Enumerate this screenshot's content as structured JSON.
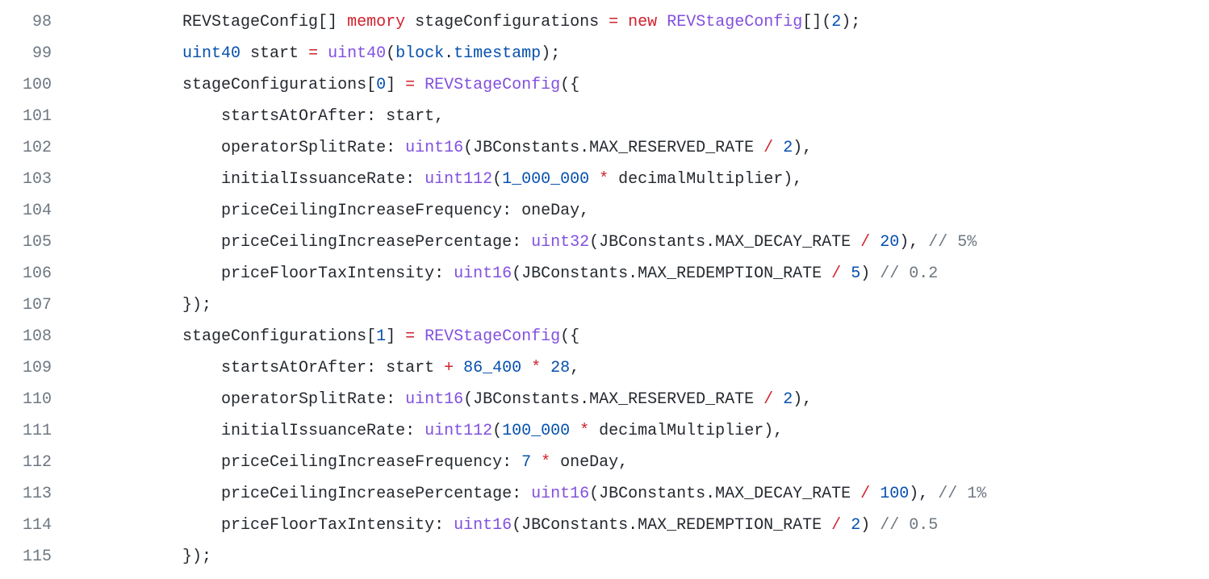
{
  "lines": [
    {
      "num": "98",
      "indent": 3,
      "tokens": [
        {
          "t": "pl",
          "v": "REVStageConfig[] "
        },
        {
          "t": "kw-red",
          "v": "memory"
        },
        {
          "t": "pl",
          "v": " stageConfigurations "
        },
        {
          "t": "op",
          "v": "="
        },
        {
          "t": "pl",
          "v": " "
        },
        {
          "t": "kw-red",
          "v": "new"
        },
        {
          "t": "pl",
          "v": " "
        },
        {
          "t": "fn",
          "v": "REVStageConfig"
        },
        {
          "t": "pl",
          "v": "[]("
        },
        {
          "t": "kw-blue",
          "v": "2"
        },
        {
          "t": "pl",
          "v": ");"
        }
      ]
    },
    {
      "num": "99",
      "indent": 3,
      "tokens": [
        {
          "t": "kw-blue",
          "v": "uint40"
        },
        {
          "t": "pl",
          "v": " start "
        },
        {
          "t": "op",
          "v": "="
        },
        {
          "t": "pl",
          "v": " "
        },
        {
          "t": "fn",
          "v": "uint40"
        },
        {
          "t": "pl",
          "v": "("
        },
        {
          "t": "kw-blue",
          "v": "block"
        },
        {
          "t": "pl",
          "v": "."
        },
        {
          "t": "kw-blue",
          "v": "timestamp"
        },
        {
          "t": "pl",
          "v": ");"
        }
      ]
    },
    {
      "num": "100",
      "indent": 3,
      "tokens": [
        {
          "t": "pl",
          "v": "stageConfigurations["
        },
        {
          "t": "kw-blue",
          "v": "0"
        },
        {
          "t": "pl",
          "v": "] "
        },
        {
          "t": "op",
          "v": "="
        },
        {
          "t": "pl",
          "v": " "
        },
        {
          "t": "fn",
          "v": "REVStageConfig"
        },
        {
          "t": "pl",
          "v": "({"
        }
      ]
    },
    {
      "num": "101",
      "indent": 4,
      "tokens": [
        {
          "t": "pl",
          "v": "startsAtOrAfter: start,"
        }
      ]
    },
    {
      "num": "102",
      "indent": 4,
      "tokens": [
        {
          "t": "pl",
          "v": "operatorSplitRate: "
        },
        {
          "t": "fn",
          "v": "uint16"
        },
        {
          "t": "pl",
          "v": "(JBConstants.MAX_RESERVED_RATE "
        },
        {
          "t": "op",
          "v": "/"
        },
        {
          "t": "pl",
          "v": " "
        },
        {
          "t": "kw-blue",
          "v": "2"
        },
        {
          "t": "pl",
          "v": "),"
        }
      ]
    },
    {
      "num": "103",
      "indent": 4,
      "tokens": [
        {
          "t": "pl",
          "v": "initialIssuanceRate: "
        },
        {
          "t": "fn",
          "v": "uint112"
        },
        {
          "t": "pl",
          "v": "("
        },
        {
          "t": "kw-blue",
          "v": "1_000_000"
        },
        {
          "t": "pl",
          "v": " "
        },
        {
          "t": "op",
          "v": "*"
        },
        {
          "t": "pl",
          "v": " decimalMultiplier),"
        }
      ]
    },
    {
      "num": "104",
      "indent": 4,
      "tokens": [
        {
          "t": "pl",
          "v": "priceCeilingIncreaseFrequency: oneDay,"
        }
      ]
    },
    {
      "num": "105",
      "indent": 4,
      "tokens": [
        {
          "t": "pl",
          "v": "priceCeilingIncreasePercentage: "
        },
        {
          "t": "fn",
          "v": "uint32"
        },
        {
          "t": "pl",
          "v": "(JBConstants.MAX_DECAY_RATE "
        },
        {
          "t": "op",
          "v": "/"
        },
        {
          "t": "pl",
          "v": " "
        },
        {
          "t": "kw-blue",
          "v": "20"
        },
        {
          "t": "pl",
          "v": "), "
        },
        {
          "t": "cm",
          "v": "// 5%"
        }
      ]
    },
    {
      "num": "106",
      "indent": 4,
      "tokens": [
        {
          "t": "pl",
          "v": "priceFloorTaxIntensity: "
        },
        {
          "t": "fn",
          "v": "uint16"
        },
        {
          "t": "pl",
          "v": "(JBConstants.MAX_REDEMPTION_RATE "
        },
        {
          "t": "op",
          "v": "/"
        },
        {
          "t": "pl",
          "v": " "
        },
        {
          "t": "kw-blue",
          "v": "5"
        },
        {
          "t": "pl",
          "v": ") "
        },
        {
          "t": "cm",
          "v": "// 0.2"
        }
      ]
    },
    {
      "num": "107",
      "indent": 3,
      "tokens": [
        {
          "t": "pl",
          "v": "});"
        }
      ]
    },
    {
      "num": "108",
      "indent": 3,
      "tokens": [
        {
          "t": "pl",
          "v": "stageConfigurations["
        },
        {
          "t": "kw-blue",
          "v": "1"
        },
        {
          "t": "pl",
          "v": "] "
        },
        {
          "t": "op",
          "v": "="
        },
        {
          "t": "pl",
          "v": " "
        },
        {
          "t": "fn",
          "v": "REVStageConfig"
        },
        {
          "t": "pl",
          "v": "({"
        }
      ]
    },
    {
      "num": "109",
      "indent": 4,
      "tokens": [
        {
          "t": "pl",
          "v": "startsAtOrAfter: start "
        },
        {
          "t": "op",
          "v": "+"
        },
        {
          "t": "pl",
          "v": " "
        },
        {
          "t": "kw-blue",
          "v": "86_400"
        },
        {
          "t": "pl",
          "v": " "
        },
        {
          "t": "op",
          "v": "*"
        },
        {
          "t": "pl",
          "v": " "
        },
        {
          "t": "kw-blue",
          "v": "28"
        },
        {
          "t": "pl",
          "v": ","
        }
      ]
    },
    {
      "num": "110",
      "indent": 4,
      "tokens": [
        {
          "t": "pl",
          "v": "operatorSplitRate: "
        },
        {
          "t": "fn",
          "v": "uint16"
        },
        {
          "t": "pl",
          "v": "(JBConstants.MAX_RESERVED_RATE "
        },
        {
          "t": "op",
          "v": "/"
        },
        {
          "t": "pl",
          "v": " "
        },
        {
          "t": "kw-blue",
          "v": "2"
        },
        {
          "t": "pl",
          "v": "),"
        }
      ]
    },
    {
      "num": "111",
      "indent": 4,
      "tokens": [
        {
          "t": "pl",
          "v": "initialIssuanceRate: "
        },
        {
          "t": "fn",
          "v": "uint112"
        },
        {
          "t": "pl",
          "v": "("
        },
        {
          "t": "kw-blue",
          "v": "100_000"
        },
        {
          "t": "pl",
          "v": " "
        },
        {
          "t": "op",
          "v": "*"
        },
        {
          "t": "pl",
          "v": " decimalMultiplier),"
        }
      ]
    },
    {
      "num": "112",
      "indent": 4,
      "tokens": [
        {
          "t": "pl",
          "v": "priceCeilingIncreaseFrequency: "
        },
        {
          "t": "kw-blue",
          "v": "7"
        },
        {
          "t": "pl",
          "v": " "
        },
        {
          "t": "op",
          "v": "*"
        },
        {
          "t": "pl",
          "v": " oneDay,"
        }
      ]
    },
    {
      "num": "113",
      "indent": 4,
      "tokens": [
        {
          "t": "pl",
          "v": "priceCeilingIncreasePercentage: "
        },
        {
          "t": "fn",
          "v": "uint16"
        },
        {
          "t": "pl",
          "v": "(JBConstants.MAX_DECAY_RATE "
        },
        {
          "t": "op",
          "v": "/"
        },
        {
          "t": "pl",
          "v": " "
        },
        {
          "t": "kw-blue",
          "v": "100"
        },
        {
          "t": "pl",
          "v": "), "
        },
        {
          "t": "cm",
          "v": "// 1%"
        }
      ]
    },
    {
      "num": "114",
      "indent": 4,
      "tokens": [
        {
          "t": "pl",
          "v": "priceFloorTaxIntensity: "
        },
        {
          "t": "fn",
          "v": "uint16"
        },
        {
          "t": "pl",
          "v": "(JBConstants.MAX_REDEMPTION_RATE "
        },
        {
          "t": "op",
          "v": "/"
        },
        {
          "t": "pl",
          "v": " "
        },
        {
          "t": "kw-blue",
          "v": "2"
        },
        {
          "t": "pl",
          "v": ") "
        },
        {
          "t": "cm",
          "v": "// 0.5"
        }
      ]
    },
    {
      "num": "115",
      "indent": 3,
      "tokens": [
        {
          "t": "pl",
          "v": "});"
        }
      ]
    }
  ],
  "indent_unit": "    "
}
